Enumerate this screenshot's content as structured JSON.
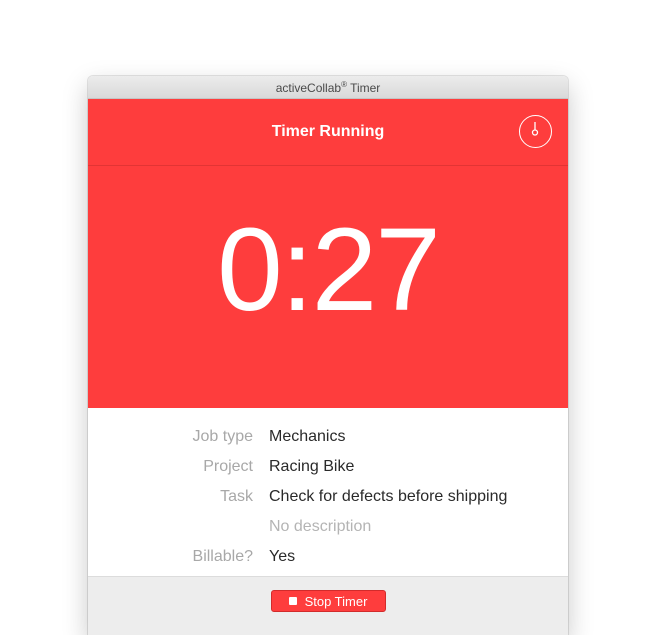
{
  "window": {
    "app_name": "activeCollab",
    "title_suffix": " Timer",
    "registered_mark": "®"
  },
  "header": {
    "title": "Timer Running",
    "timer_icon": "stopwatch-icon"
  },
  "timer": {
    "elapsed": "0:27"
  },
  "details": {
    "job_type": {
      "label": "Job type",
      "value": "Mechanics"
    },
    "project": {
      "label": "Project",
      "value": "Racing Bike"
    },
    "task": {
      "label": "Task",
      "value": "Check for defects before shipping"
    },
    "description": {
      "label": "",
      "value": "No description"
    },
    "billable": {
      "label": "Billable?",
      "value": "Yes"
    }
  },
  "footer": {
    "stop_label": "Stop Timer",
    "stop_icon": "stop-square-icon"
  },
  "colors": {
    "accent": "#fe3d3d",
    "footer_bg": "#ededed",
    "label_text": "#a8a8a8"
  }
}
